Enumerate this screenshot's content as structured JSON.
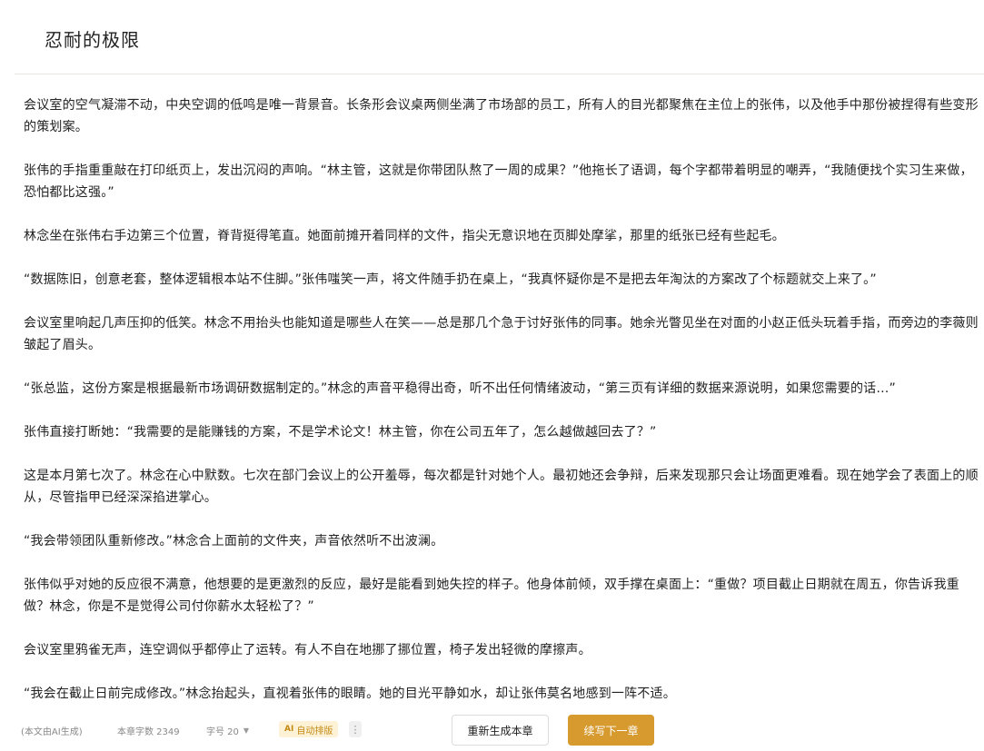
{
  "header": {
    "title": "忍耐的极限"
  },
  "article": {
    "paragraphs": [
      "会议室的空气凝滞不动，中央空调的低鸣是唯一背景音。长条形会议桌两侧坐满了市场部的员工，所有人的目光都聚焦在主位上的张伟，以及他手中那份被捏得有些变形的策划案。",
      "张伟的手指重重敲在打印纸页上，发出沉闷的声响。“林主管，这就是你带团队熬了一周的成果？”他拖长了语调，每个字都带着明显的嘲弄，“我随便找个实习生来做，恐怕都比这强。”",
      "林念坐在张伟右手边第三个位置，脊背挺得笔直。她面前摊开着同样的文件，指尖无意识地在页脚处摩挲，那里的纸张已经有些起毛。",
      "“数据陈旧，创意老套，整体逻辑根本站不住脚。”张伟嗤笑一声，将文件随手扔在桌上，“我真怀疑你是不是把去年淘汰的方案改了个标题就交上来了。”",
      "会议室里响起几声压抑的低笑。林念不用抬头也能知道是哪些人在笑——总是那几个急于讨好张伟的同事。她余光瞥见坐在对面的小赵正低头玩着手指，而旁边的李薇则皱起了眉头。",
      "“张总监，这份方案是根据最新市场调研数据制定的。”林念的声音平稳得出奇，听不出任何情绪波动，“第三页有详细的数据来源说明，如果您需要的话…”",
      "张伟直接打断她：“我需要的是能赚钱的方案，不是学术论文！林主管，你在公司五年了，怎么越做越回去了？”",
      "这是本月第七次了。林念在心中默数。七次在部门会议上的公开羞辱，每次都是针对她个人。最初她还会争辩，后来发现那只会让场面更难看。现在她学会了表面上的顺从，尽管指甲已经深深掐进掌心。",
      "“我会带领团队重新修改。”林念合上面前的文件夹，声音依然听不出波澜。",
      "张伟似乎对她的反应很不满意，他想要的是更激烈的反应，最好是能看到她失控的样子。他身体前倾，双手撑在桌面上：“重做？项目截止日期就在周五，你告诉我重做？林念，你是不是觉得公司付你薪水太轻松了？”",
      "会议室里鸦雀无声，连空调似乎都停止了运转。有人不自在地挪了挪位置，椅子发出轻微的摩擦声。",
      "“我会在截止日前完成修改。”林念抬起头，直视着张伟的眼睛。她的目光平静如水，却让张伟莫名地感到一阵不适。"
    ]
  },
  "footer": {
    "ai_note": "(本文由AI生成)",
    "word_count": "本章字数 2349",
    "font_size": "字号 20",
    "font_caret": "▼",
    "auto_format_icon": "AI",
    "auto_format": "自动排版",
    "more": "⋮",
    "regenerate": "重新生成本章",
    "continue": "续写下一章"
  },
  "colors": {
    "accent": "#d69a2f",
    "auto_bg": "#fdf1d6",
    "auto_text": "#c48a12"
  }
}
